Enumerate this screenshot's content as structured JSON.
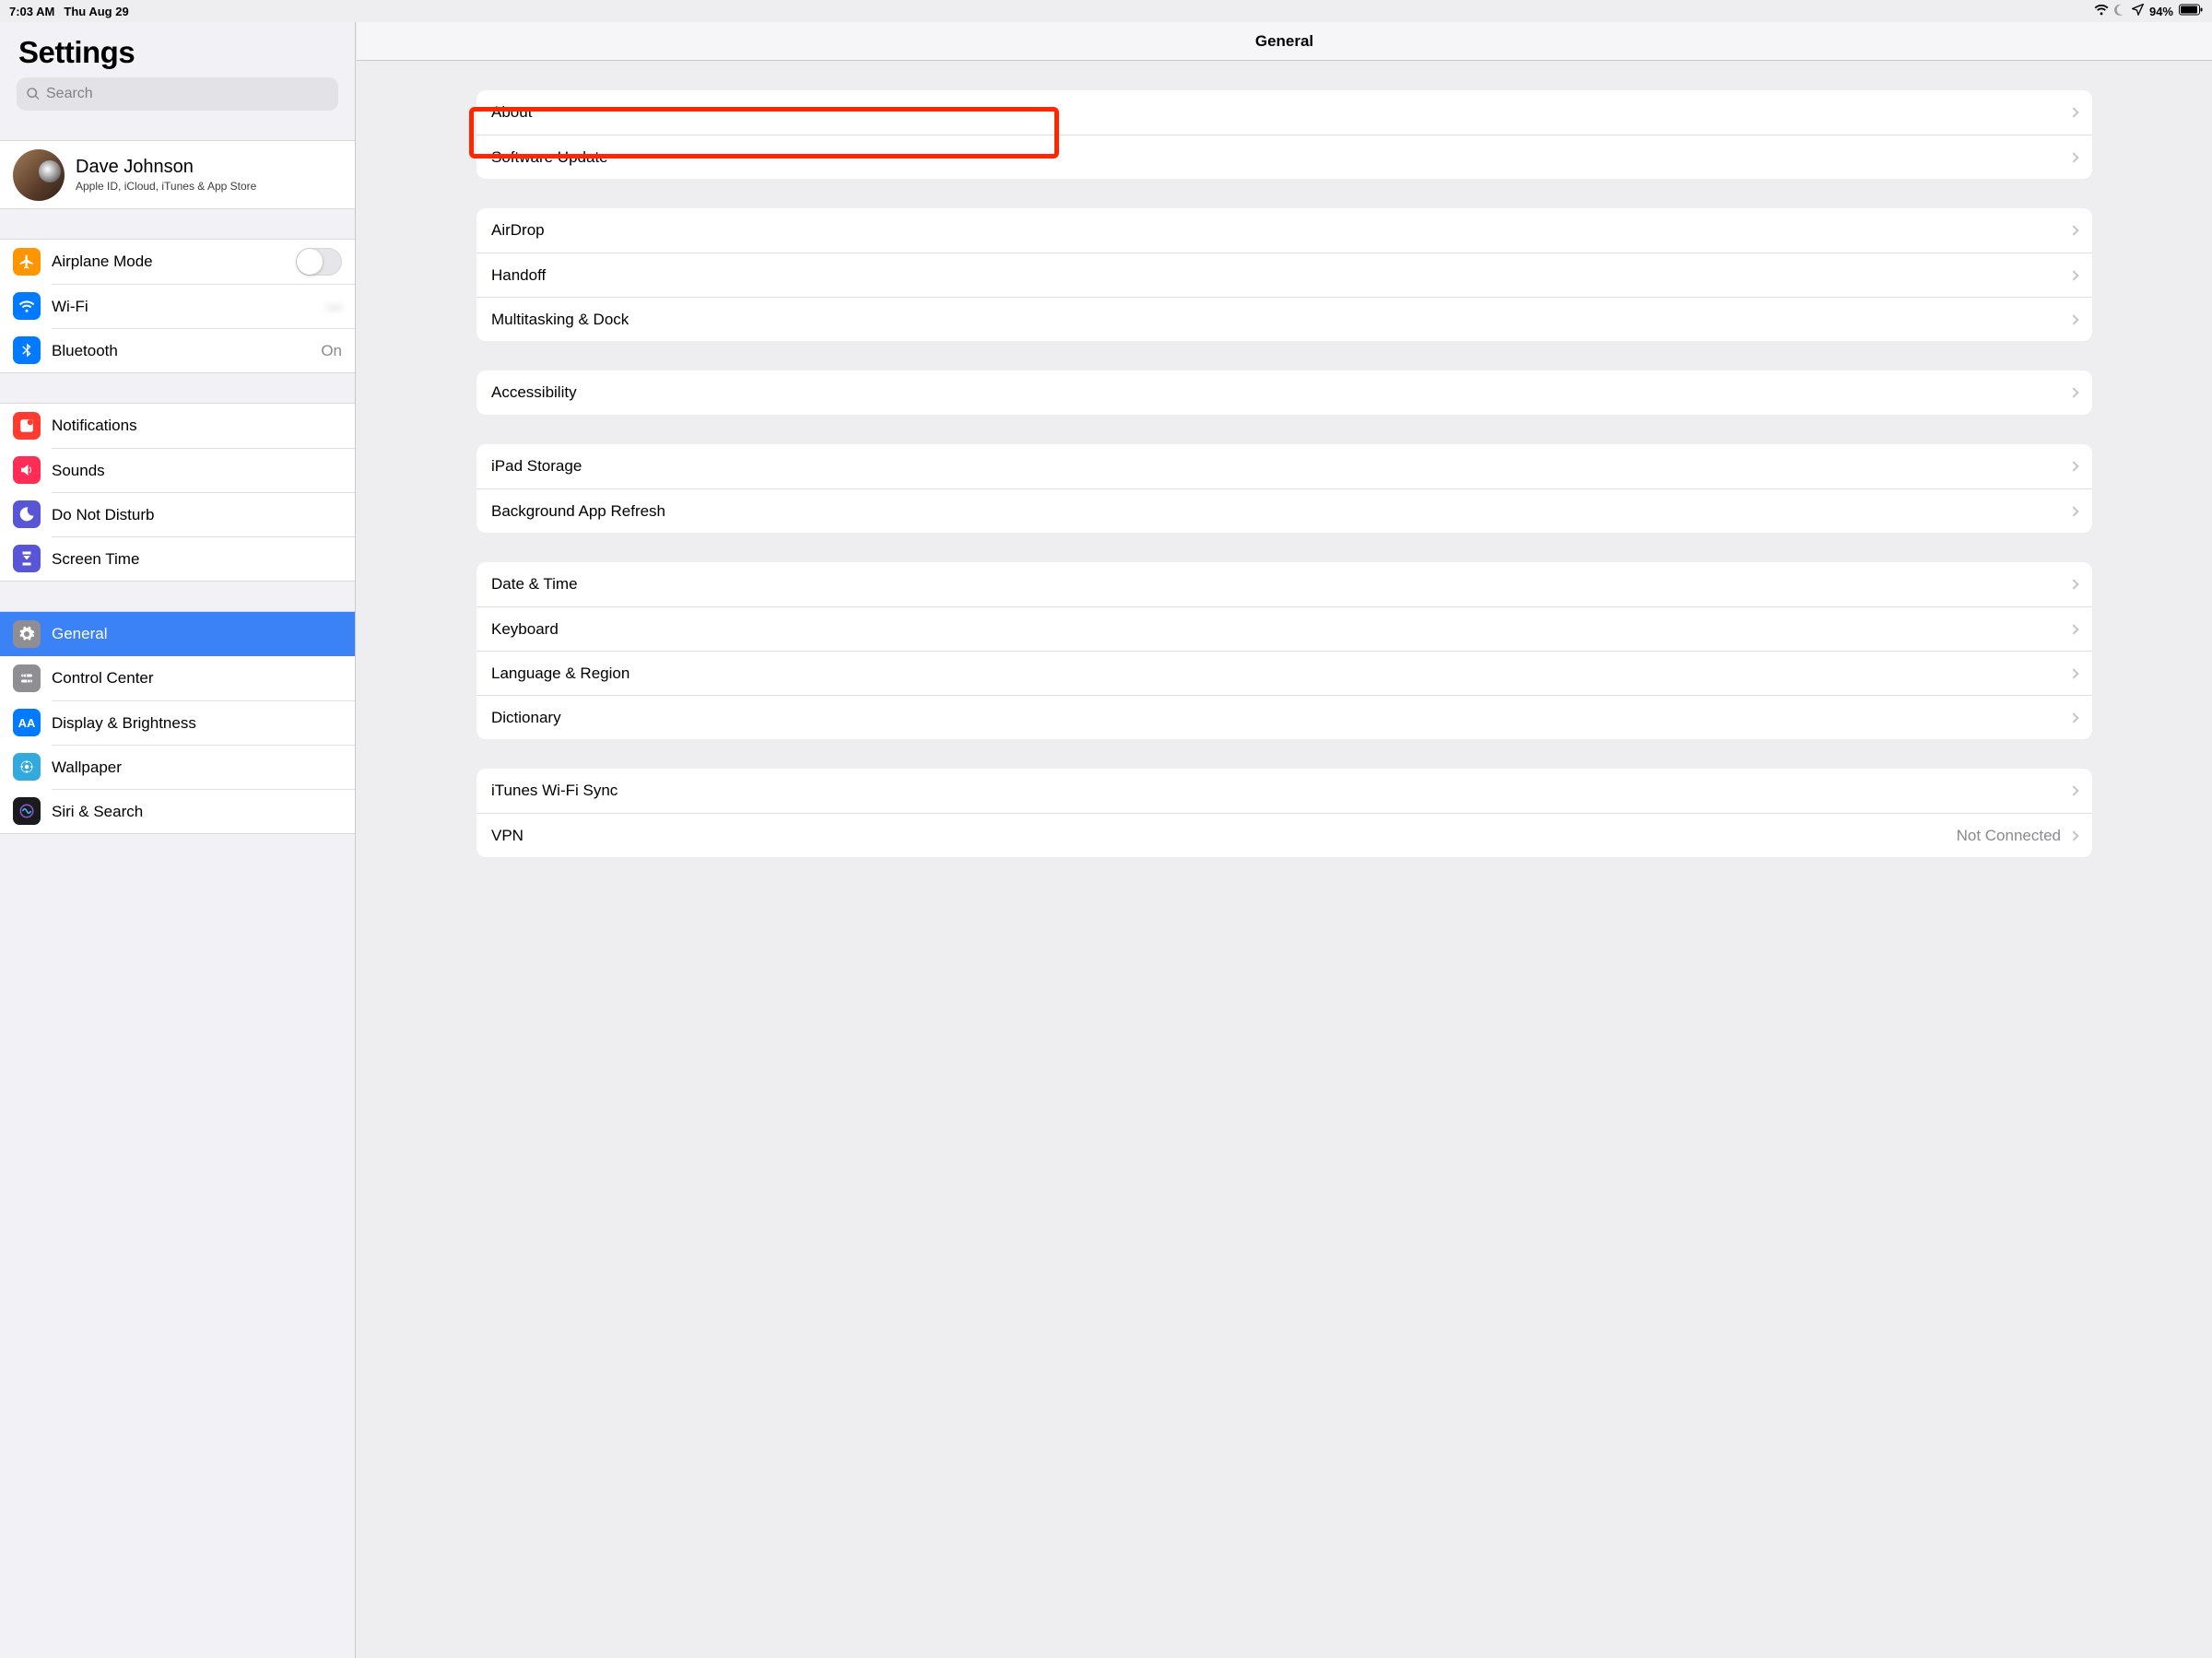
{
  "status_bar": {
    "time": "7:03 AM",
    "date": "Thu Aug 29",
    "battery_pct": "94%"
  },
  "sidebar": {
    "title": "Settings",
    "search_placeholder": "Search",
    "apple_id": {
      "name": "Dave Johnson",
      "subtitle": "Apple ID, iCloud, iTunes & App Store"
    },
    "group1": {
      "airplane": "Airplane Mode",
      "wifi": "Wi-Fi",
      "wifi_value": "—",
      "bluetooth": "Bluetooth",
      "bluetooth_value": "On"
    },
    "group2": {
      "notifications": "Notifications",
      "sounds": "Sounds",
      "dnd": "Do Not Disturb",
      "screentime": "Screen Time"
    },
    "group3": {
      "general": "General",
      "control": "Control Center",
      "display": "Display & Brightness",
      "wallpaper": "Wallpaper",
      "siri": "Siri & Search"
    }
  },
  "detail": {
    "title": "General",
    "g1": {
      "about": "About",
      "update": "Software Update"
    },
    "g2": {
      "airdrop": "AirDrop",
      "handoff": "Handoff",
      "multi": "Multitasking & Dock"
    },
    "g3": {
      "access": "Accessibility"
    },
    "g4": {
      "storage": "iPad Storage",
      "bgrefresh": "Background App Refresh"
    },
    "g5": {
      "datetime": "Date & Time",
      "keyboard": "Keyboard",
      "language": "Language & Region",
      "dictionary": "Dictionary"
    },
    "g6": {
      "itunes": "iTunes Wi-Fi Sync",
      "vpn": "VPN",
      "vpn_value": "Not Connected"
    }
  },
  "colors": {
    "orange": "#ff9500",
    "blue": "#007aff",
    "red": "#ff3b30",
    "purple": "#5856d6",
    "magenta": "#ff2d55",
    "gray": "#8e8e93",
    "teal": "#34aadc"
  }
}
